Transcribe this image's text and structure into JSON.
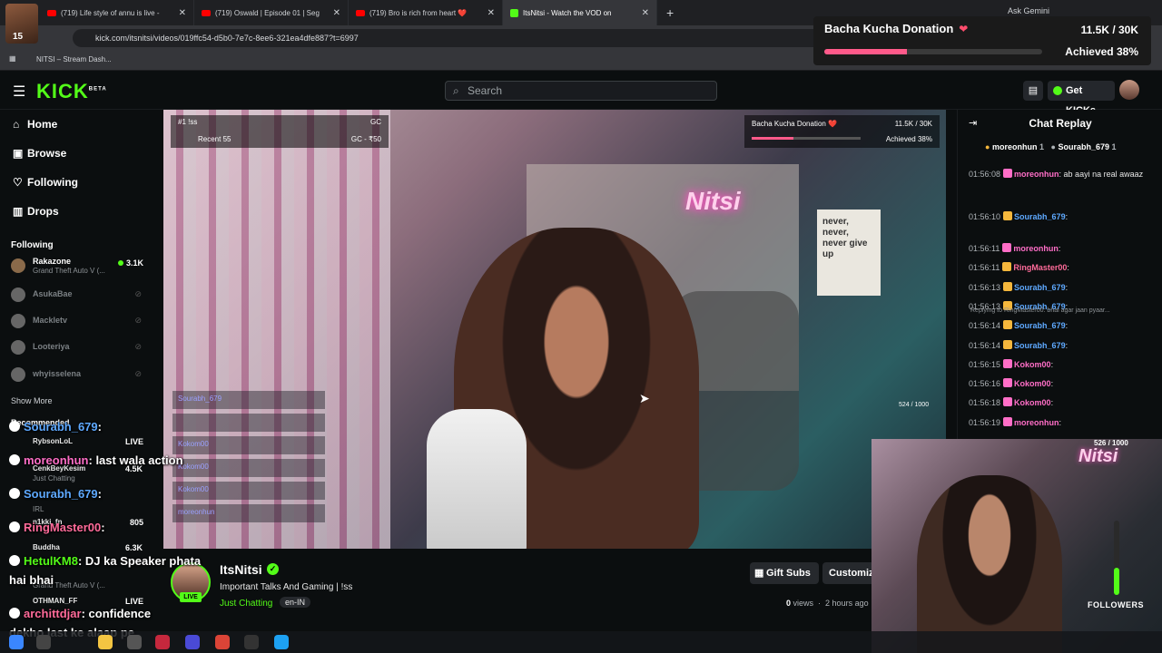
{
  "browser": {
    "tabs": [
      {
        "title": "(719) Life style of annu is live -",
        "kind": "yt"
      },
      {
        "title": "(719) Oswald | Episode 01 | Seg",
        "kind": "yt"
      },
      {
        "title": "(719) Bro is rich from heart ❤️",
        "kind": "yt"
      },
      {
        "title": "ItsNitsi - Watch the VOD on",
        "kind": "kick",
        "active": true
      }
    ],
    "new_tab": "+",
    "ask_gemini": "Ask Gemini",
    "url": "kick.com/itsnitsi/videos/019ffc54-d5b0-7e7c-8ee6-321ea4dfe887?t=6997",
    "bookmark": "NITSI – Stream Dash...",
    "profile_badge": "15"
  },
  "donation_overlay": {
    "title": "Bacha Kucha Donation",
    "amount": "11.5K / 30K",
    "achieved": "Achieved 38%",
    "progress": 0.38
  },
  "header": {
    "logo": "KICK",
    "logo_sup": "BETA",
    "search_placeholder": "Search",
    "get_kicks": "Get KICKs"
  },
  "sidebar": {
    "nav": [
      "Home",
      "Browse",
      "Following",
      "Drops"
    ],
    "following_title": "Following",
    "channels": [
      {
        "name": "Rakazone",
        "sub": "Grand Theft Auto V (...",
        "viewers": "3.1K",
        "live": true
      },
      {
        "name": "AsukaBae",
        "live": false
      },
      {
        "name": "Mackletv",
        "live": false
      },
      {
        "name": "Looteriya",
        "live": false
      },
      {
        "name": "whyisselena",
        "live": false
      }
    ],
    "show_more": "Show More"
  },
  "video": {
    "neon": "Nitsi",
    "overlay_top_left": "#1 !ss",
    "overlay_top_right": "GC",
    "overlay_recent": "Recent 55",
    "overlay_gc": "GC - ₹50",
    "overlay_don_title": "Bacha Kucha Donation ❤️",
    "overlay_don_amt": "11.5K / 30K",
    "overlay_don_ach": "Achieved 38%",
    "counter": "524 / 1000",
    "poster": "never, never, never give up",
    "mini_chat": [
      "Sourabh_679",
      "",
      "Kokom00",
      "Kokom00",
      "Kokom00",
      "moreonhun"
    ]
  },
  "stream_info": {
    "name": "ItsNitsi",
    "title": "Important Talks And Gaming | !ss",
    "category": "Just Chatting",
    "language": "en-IN",
    "gift_subs": "Gift Subs",
    "customize": "Customize",
    "views": "0",
    "views_label": "views",
    "ago": "2 hours ago",
    "live": "LIVE"
  },
  "chat": {
    "title": "Chat Replay",
    "pinned": [
      "moreonhun",
      "1",
      "Sourabh_679",
      "1"
    ],
    "reply_note": "Replying to RingMaster00: bhai agar jaan pyaar...",
    "messages": [
      {
        "time": "01:56:08",
        "user": "moreonhun",
        "text": ": ab aayi na real awaaz",
        "color": "pink"
      },
      {
        "time": "01:56:10",
        "user": "Sourabh_679",
        "text": ":",
        "color": "blue"
      },
      {
        "time": "01:56:11",
        "user": "moreonhun",
        "text": ":",
        "color": "pink"
      },
      {
        "time": "01:56:11",
        "user": "RingMaster00",
        "text": ":",
        "color": "rose"
      },
      {
        "time": "01:56:13",
        "user": "Sourabh_679",
        "text": ":",
        "color": "blue"
      },
      {
        "time": "01:56:13",
        "user": "Sourabh_679",
        "text": ":",
        "color": "blue"
      },
      {
        "time": "01:56:14",
        "user": "Sourabh_679",
        "text": ":",
        "color": "blue"
      },
      {
        "time": "01:56:14",
        "user": "Sourabh_679",
        "text": ":",
        "color": "blue"
      },
      {
        "time": "01:56:15",
        "user": "Kokom00",
        "text": ":",
        "color": "pink"
      },
      {
        "time": "01:56:16",
        "user": "Kokom00",
        "text": ":",
        "color": "pink"
      },
      {
        "time": "01:56:18",
        "user": "Kokom00",
        "text": ":",
        "color": "pink"
      },
      {
        "time": "01:56:19",
        "user": "moreonhun",
        "text": ":",
        "color": "pink"
      }
    ]
  },
  "webcam": {
    "neon": "Nitsi",
    "counter": "526 / 1000",
    "followers": "FOLLOWERS"
  },
  "overlay_chat": [
    {
      "user": "Sourabh_679",
      "text": ":",
      "color": "ub"
    },
    {
      "user": "moreonhun",
      "text": ": last wala action",
      "color": "up"
    },
    {
      "user": "Sourabh_679",
      "text": ":",
      "color": "ub"
    },
    {
      "user": "RingMaster00",
      "text": ":",
      "color": "ur"
    },
    {
      "user": "HetulKM8",
      "text": ": DJ ka Speaker phata",
      "color": "ug"
    },
    {
      "user": "",
      "text": "hai bhai",
      "color": "ug"
    },
    {
      "user": "archittdjar",
      "text": ": confidence",
      "color": "ur"
    },
    {
      "user": "",
      "text": "dekho last ke alaap pe",
      "color": "ur"
    }
  ],
  "recommended": {
    "title": "Recommended",
    "items": [
      {
        "name": "RybsonLoL",
        "sub": "LIVE"
      },
      {
        "name": "CenkBeyKesim",
        "sub": "Just Chatting",
        "viewers": "4.5K"
      },
      {
        "name": "n1kki_fn",
        "sub": "IRL",
        "viewers": "805"
      },
      {
        "name": "Buddha",
        "sub": "Grand Theft Auto V (...",
        "viewers": "6.3K"
      },
      {
        "name": "OTHMAN_FF",
        "sub": "LIVE"
      }
    ]
  }
}
